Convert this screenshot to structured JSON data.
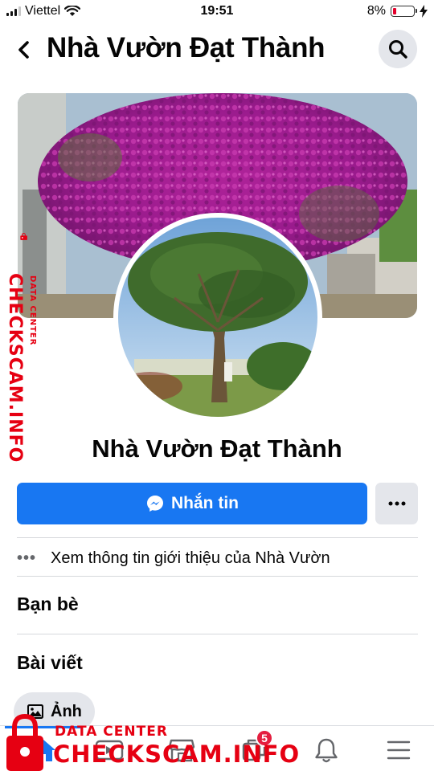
{
  "status_bar": {
    "carrier": "Viettel",
    "time": "19:51",
    "battery_percent": "8%",
    "battery_level": 0.08,
    "battery_color": "#e4002b"
  },
  "header": {
    "title": "Nhà Vườn Đạt Thành",
    "back_icon": "chevron-left-icon",
    "search_icon": "search-icon"
  },
  "profile": {
    "name": "Nhà Vườn Đạt Thành",
    "cover": "bougainvillea tree cover photo",
    "avatar": "large tree profile photo"
  },
  "actions": {
    "message_label": "Nhắn tin",
    "message_icon": "messenger-icon",
    "more_icon": "more-horizontal-icon",
    "accent_color": "#1877f2"
  },
  "about": {
    "dots": "•••",
    "text": "Xem thông tin giới thiệu của Nhà Vườn"
  },
  "sections": {
    "friends": "Bạn bè",
    "posts": "Bài viết"
  },
  "photos_chip": {
    "label": "Ảnh",
    "icon": "photo-icon"
  },
  "bottom_nav": {
    "items": [
      {
        "icon": "home-icon",
        "active": true
      },
      {
        "icon": "video-icon"
      },
      {
        "icon": "marketplace-icon"
      },
      {
        "icon": "groups-icon",
        "badge": "5"
      },
      {
        "icon": "bell-icon"
      },
      {
        "icon": "menu-icon"
      }
    ]
  },
  "watermark": {
    "side_text": "CHECKSCAM.INFO",
    "side_small": "DATA CENTER",
    "bottom_small": "DATA CENTER",
    "bottom_text": "CHECKSCAM.INFO",
    "color": "#e60012"
  }
}
